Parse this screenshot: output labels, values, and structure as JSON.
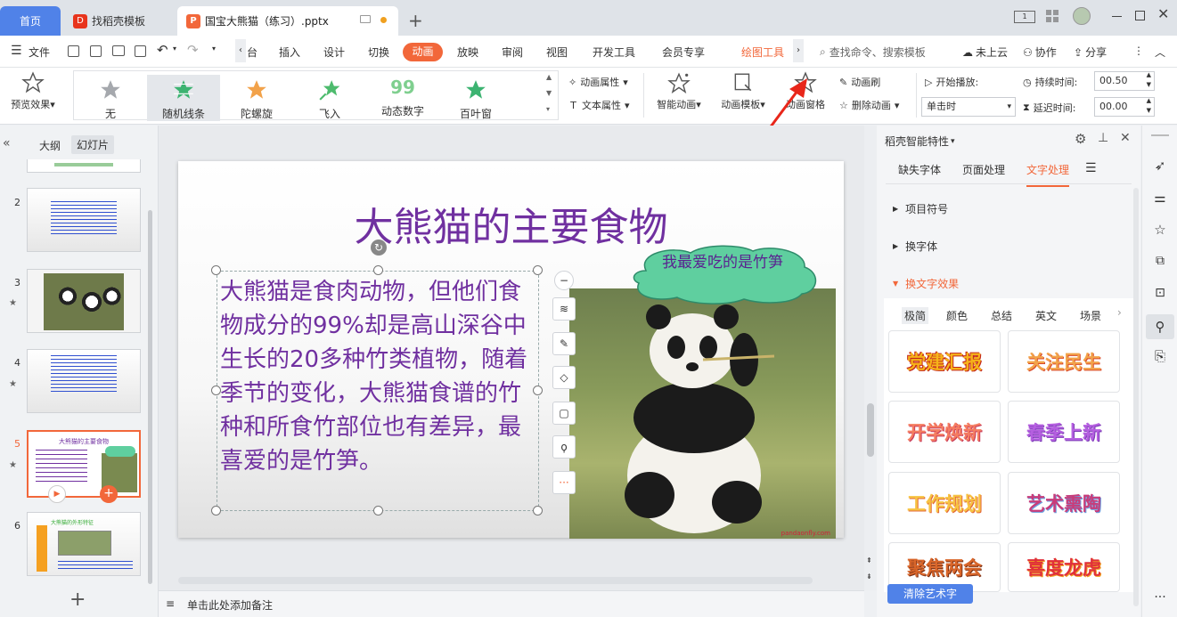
{
  "tabs": {
    "home": "首页",
    "template": "找稻壳模板",
    "file": "国宝大熊猫（练习）.pptx"
  },
  "menu": {
    "file": "文件",
    "items": [
      "台",
      "插入",
      "设计",
      "切换",
      "动画",
      "放映",
      "审阅",
      "视图",
      "开发工具",
      "会员专享"
    ],
    "drawing_tools": "绘图工具",
    "search_placeholder": "查找命令、搜索模板",
    "cloud": "未上云",
    "collab": "协作",
    "share": "分享"
  },
  "ribbon": {
    "preview": "预览效果",
    "gallery": [
      "无",
      "随机线条",
      "陀螺旋",
      "飞入",
      "动态数字",
      "百叶窗"
    ],
    "anim_props": "动画属性",
    "text_props": "文本属性",
    "smart_anim": "智能动画",
    "anim_template": "动画模板",
    "anim_pane": "动画窗格",
    "anim_brush": "动画刷",
    "delete_anim": "删除动画",
    "start_label": "开始播放:",
    "start_value": "单击时",
    "duration_label": "持续时间:",
    "duration_value": "00.50",
    "delay_label": "延迟时间:",
    "delay_value": "00.00"
  },
  "left": {
    "tab_outline": "大纲",
    "tab_slides": "幻灯片",
    "slide_numbers": [
      "2",
      "3",
      "4",
      "5",
      "6"
    ],
    "thumb5_title": "大熊猫的主要食物",
    "thumb6_title": "大熊猫的外形特征"
  },
  "slide": {
    "title": "大熊猫的主要食物",
    "body": "大熊猫是食肉动物，但他们食物成分的99%却是高山深谷中生长的20多种竹类植物，随着季节的变化，大熊猫食谱的竹种和所食竹部位也有差异，最喜爱的是竹笋。",
    "bubble": "我最爱吃的是竹笋",
    "photo_credit": "pandaonfly.com"
  },
  "notes": "单击此处添加备注",
  "right": {
    "title": "稻壳智能特性",
    "tabs": [
      "缺失字体",
      "页面处理",
      "文字处理"
    ],
    "sections": [
      "项目符号",
      "换字体",
      "换文字效果"
    ],
    "effect_tabs": [
      "极简",
      "颜色",
      "总结",
      "英文",
      "场景"
    ],
    "effects": [
      "党建汇报",
      "关注民生",
      "开学焕新",
      "春季上新",
      "工作规划",
      "艺术熏陶",
      "聚焦两会",
      "喜度龙虎"
    ],
    "clear_btn": "清除艺术字"
  },
  "colors": {
    "accent": "#f2673a",
    "tab_blue": "#5082e8",
    "title_purple": "#7030a0",
    "bubble_green": "#5fcf9f"
  }
}
